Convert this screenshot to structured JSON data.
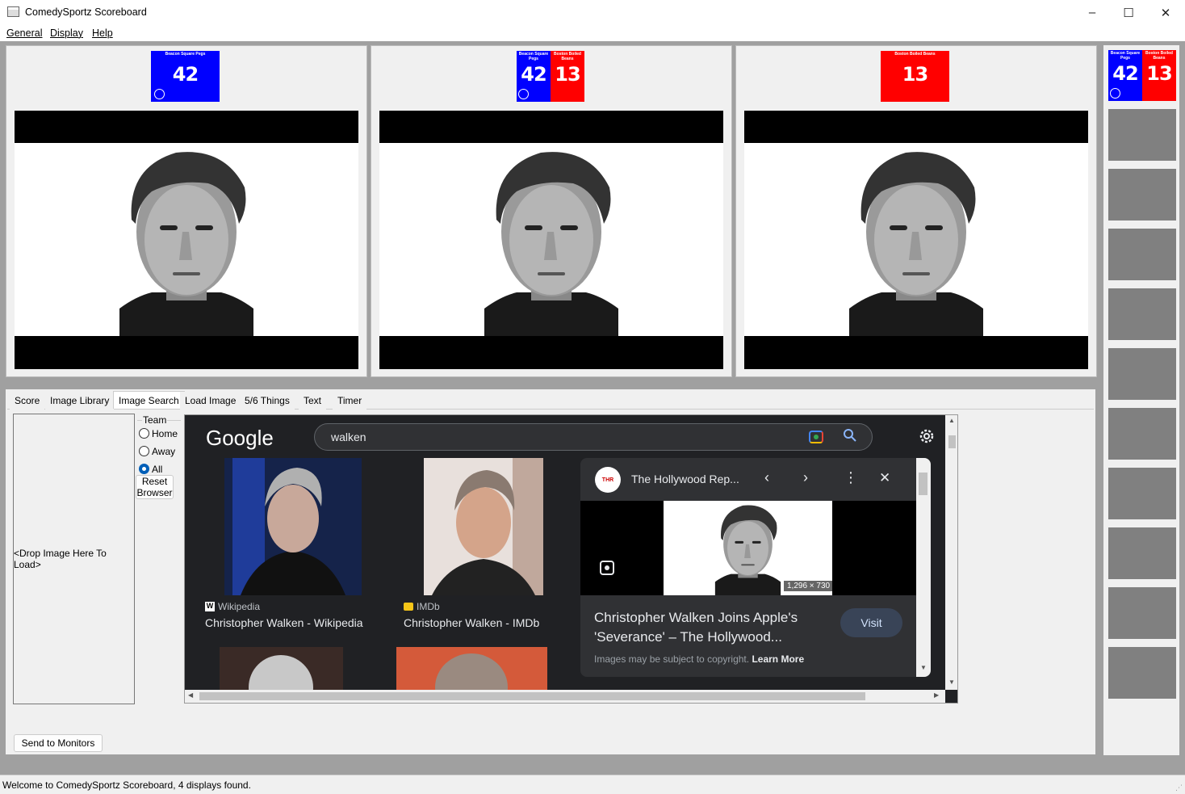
{
  "window": {
    "title": "ComedySportz Scoreboard",
    "minimize": "–",
    "maximize": "☐",
    "close": "✕"
  },
  "menu": [
    "General",
    "Display",
    "Help"
  ],
  "teams": {
    "home": {
      "name": "Beacon Square Pegs",
      "score": "42",
      "color": "#0000ff"
    },
    "away": {
      "name": "Boston Boiled Beans",
      "score": "13",
      "color": "#ff0000"
    }
  },
  "tabs": [
    "Score",
    "Image Library",
    "Image Search",
    "Load Image",
    "5/6 Things",
    "Text",
    "Timer"
  ],
  "active_tab": "Image Search",
  "dropzone_label": "<Drop Image Here To Load>",
  "team_group": {
    "title": "Team",
    "options": [
      "Home",
      "Away",
      "All"
    ],
    "selected": "All"
  },
  "reset_browser_label": [
    "Reset",
    "Browser"
  ],
  "send_button": "Send to Monitors",
  "browser": {
    "logo": "Google",
    "query": "walken",
    "results": [
      {
        "source": "Wikipedia",
        "title": "Christopher Walken - Wikipedia"
      },
      {
        "source": "IMDb",
        "title": "Christopher Walken - IMDb"
      }
    ],
    "panel": {
      "site": "The Hollywood Rep...",
      "site_logo": "THR",
      "dimensions": "1,296 × 730",
      "headline_1": "Christopher Walken Joins Apple's",
      "headline_2": "'Severance' – The Hollywood...",
      "visit": "Visit",
      "copyright": "Images may be subject to copyright.",
      "learn_more": "Learn More"
    }
  },
  "status": "Welcome to ComedySportz Scoreboard, 4 displays found."
}
